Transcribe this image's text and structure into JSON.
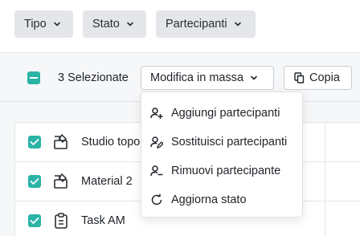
{
  "filters": [
    {
      "label": "Tipo"
    },
    {
      "label": "Stato"
    },
    {
      "label": "Partecipanti"
    }
  ],
  "toolbar": {
    "selected_label": "3 Selezionate",
    "bulk_edit_label": "Modifica in massa",
    "copy_label": "Copia"
  },
  "rows": [
    {
      "name": "Studio topo",
      "icon": "deliverable-icon",
      "checked": true
    },
    {
      "name": "Material 2",
      "icon": "deliverable-icon",
      "checked": true
    },
    {
      "name": "Task AM",
      "icon": "clipboard-icon",
      "checked": true
    }
  ],
  "bulk_menu": {
    "items": [
      {
        "label": "Aggiungi partecipanti",
        "icon": "user-add-icon"
      },
      {
        "label": "Sostituisci partecipanti",
        "icon": "user-replace-icon"
      },
      {
        "label": "Rimuovi partecipante",
        "icon": "user-remove-icon"
      },
      {
        "label": "Aggiorna stato",
        "icon": "refresh-icon"
      }
    ]
  },
  "colors": {
    "accent": "#2bb3a6",
    "filter_bg": "#e4e6e9",
    "border": "#e3e5e8"
  }
}
